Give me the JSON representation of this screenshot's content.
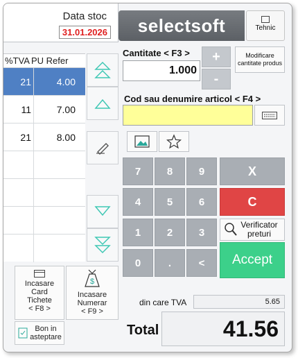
{
  "header": {
    "date_label": "Data stoc",
    "date_value": "31.01.2026",
    "logo_text": "selectsoft",
    "tehnic_label": "Tehnic"
  },
  "table": {
    "columns": [
      "%TVA",
      "PU Refer"
    ],
    "rows": [
      {
        "tva": "21",
        "pu": "4.00",
        "selected": true
      },
      {
        "tva": "11",
        "pu": "7.00",
        "selected": false
      },
      {
        "tva": "21",
        "pu": "8.00",
        "selected": false
      }
    ]
  },
  "quantity": {
    "label": "Cantitate  < F3 >",
    "value": "1.000",
    "plus": "+",
    "minus": "-",
    "modify_label": "Modificare cantitate produs"
  },
  "article": {
    "label": "Cod sau denumire articol < F4 >",
    "value": ""
  },
  "keypad": {
    "digits": [
      "7",
      "8",
      "9",
      "4",
      "5",
      "6",
      "1",
      "2",
      "3",
      "0",
      ".",
      "<"
    ],
    "clear_all": "X",
    "clear": "C",
    "price_check": "Verificator preturi",
    "accept": "Accept"
  },
  "payments": {
    "card_tickets": [
      "Incasare",
      "Card",
      "Tichete",
      "< F8 >"
    ],
    "cash": [
      "Incasare",
      "Numerar",
      "< F9 >"
    ],
    "pending": [
      "Bon in",
      "asteptare"
    ]
  },
  "totals": {
    "tva_label": "din care TVA",
    "tva_value": "5.65",
    "total_label": "Total",
    "total_value": "41.56"
  },
  "colors": {
    "selected_row": "#4f80c4",
    "clear_red": "#e04545",
    "accept_green": "#3cd08a",
    "article_yellow": "#ffff99",
    "date_red": "#e02020"
  }
}
